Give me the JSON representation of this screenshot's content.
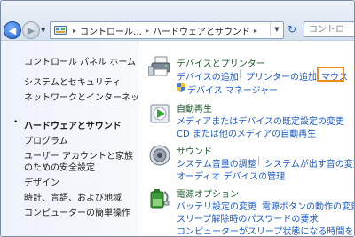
{
  "nav": {
    "back_glyph": "◀",
    "forward_glyph": "▶",
    "history_glyph": "▼"
  },
  "address": {
    "crumbs": [
      "コントロール…",
      "ハードウェアとサウンド"
    ],
    "separator": "▸",
    "dropdown_glyph": "▼",
    "refresh_glyph": "↻"
  },
  "search": {
    "placeholder": "コントロ"
  },
  "sidebar": {
    "items": [
      {
        "label": "コントロール パネル ホーム"
      },
      {
        "label": "システムとセキュリティ"
      },
      {
        "label": "ネットワークとインターネット"
      },
      {
        "label": "ハードウェアとサウンド",
        "current": true
      },
      {
        "label": "プログラム"
      },
      {
        "label": "ユーザー アカウントと家族"
      },
      {
        "label": "のための安全設定"
      },
      {
        "label": "デザイン"
      },
      {
        "label": "時計、言語、および地域"
      },
      {
        "label": "コンピューターの簡単操作"
      }
    ],
    "bullet": "•"
  },
  "categories": {
    "devices": {
      "title": "デバイスとプリンター",
      "links": [
        "デバイスの追加",
        "プリンターの追加",
        "マウス",
        "デバイス マネージャー"
      ]
    },
    "autoplay": {
      "title": "自動再生",
      "links": [
        "メディアまたはデバイスの既定設定の変更",
        "CD または他のメディアの自動再生"
      ]
    },
    "sound": {
      "title": "サウンド",
      "links": [
        "システム音量の調整",
        "システムが出す音の変更",
        "オーディオ デバイスの管理"
      ]
    },
    "power": {
      "title": "電源オプション",
      "links": [
        "バッテリ設定の変更",
        "電源ボタンの動作の変更",
        "スリープ解除時のパスワードの要求",
        "コンピューターがスリープ状態になる時間を変更"
      ]
    }
  },
  "highlight_color": "#f08a1a",
  "link_color": "#1a5bc4",
  "title_color": "#1e5a2c"
}
